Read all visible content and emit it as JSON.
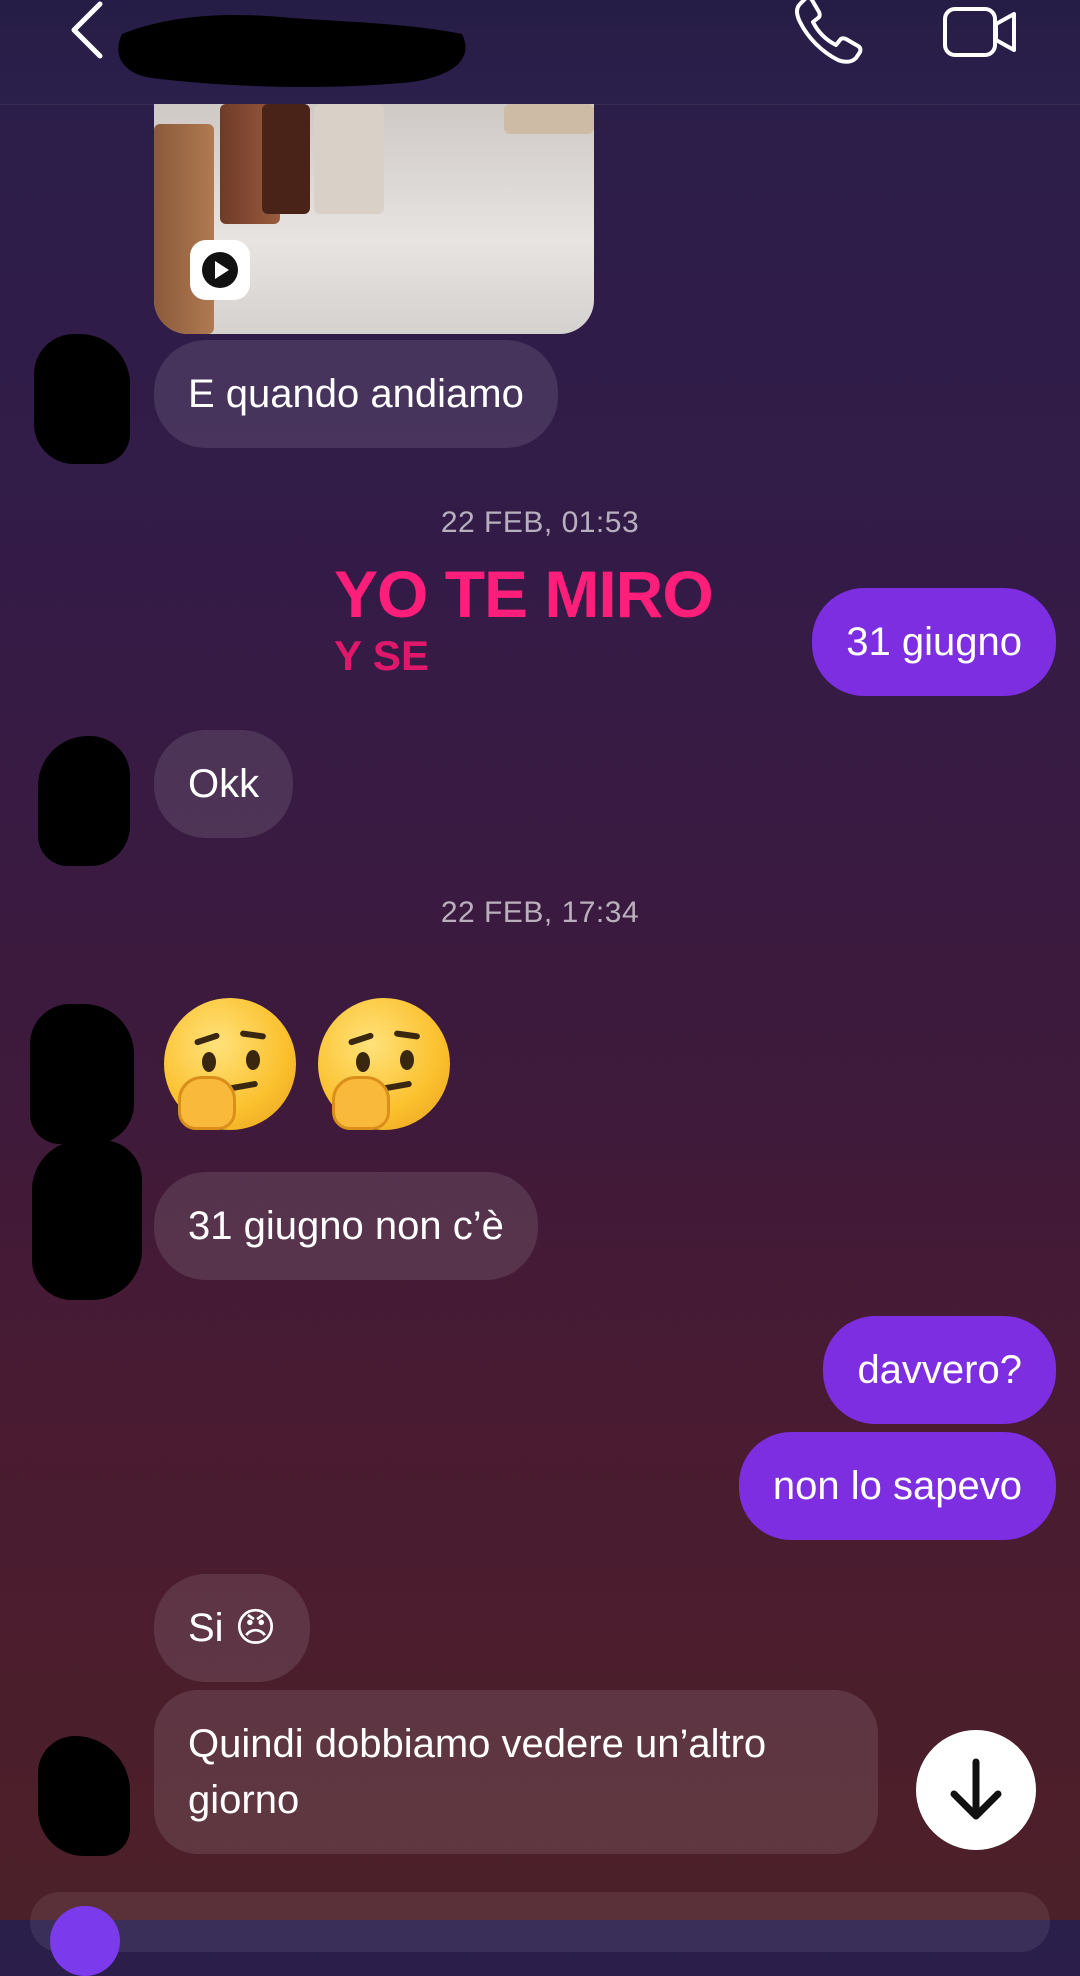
{
  "header": {
    "contact_name": "",
    "icons": [
      "back-chevron-icon",
      "phone-icon",
      "video-camera-icon"
    ]
  },
  "media": {
    "icon": "play-icon"
  },
  "messages": {
    "m1": "E quando andiamo",
    "ts1": "22 FEB, 01:53",
    "sticker_line1": "YO TE MIRO",
    "sticker_line2": "Y SE",
    "m2": "31 giugno",
    "m3": "Okk",
    "ts2": "22 FEB, 17:34",
    "m4_emoji": "🤔 🤔",
    "m5": "31 giugno non c’è",
    "m6": "davvero?",
    "m7": "non lo sapevo",
    "m8": "Si 😠",
    "m9": "Quindi dobbiamo vedere un’altro giorno"
  },
  "colors": {
    "outgoing_bubble": "#7c2ee0",
    "incoming_bubble": "rgba(255,255,255,0.11)",
    "sticker_text": "#ff1e7a"
  },
  "scroll_button": {
    "icon": "arrow-down-icon"
  }
}
